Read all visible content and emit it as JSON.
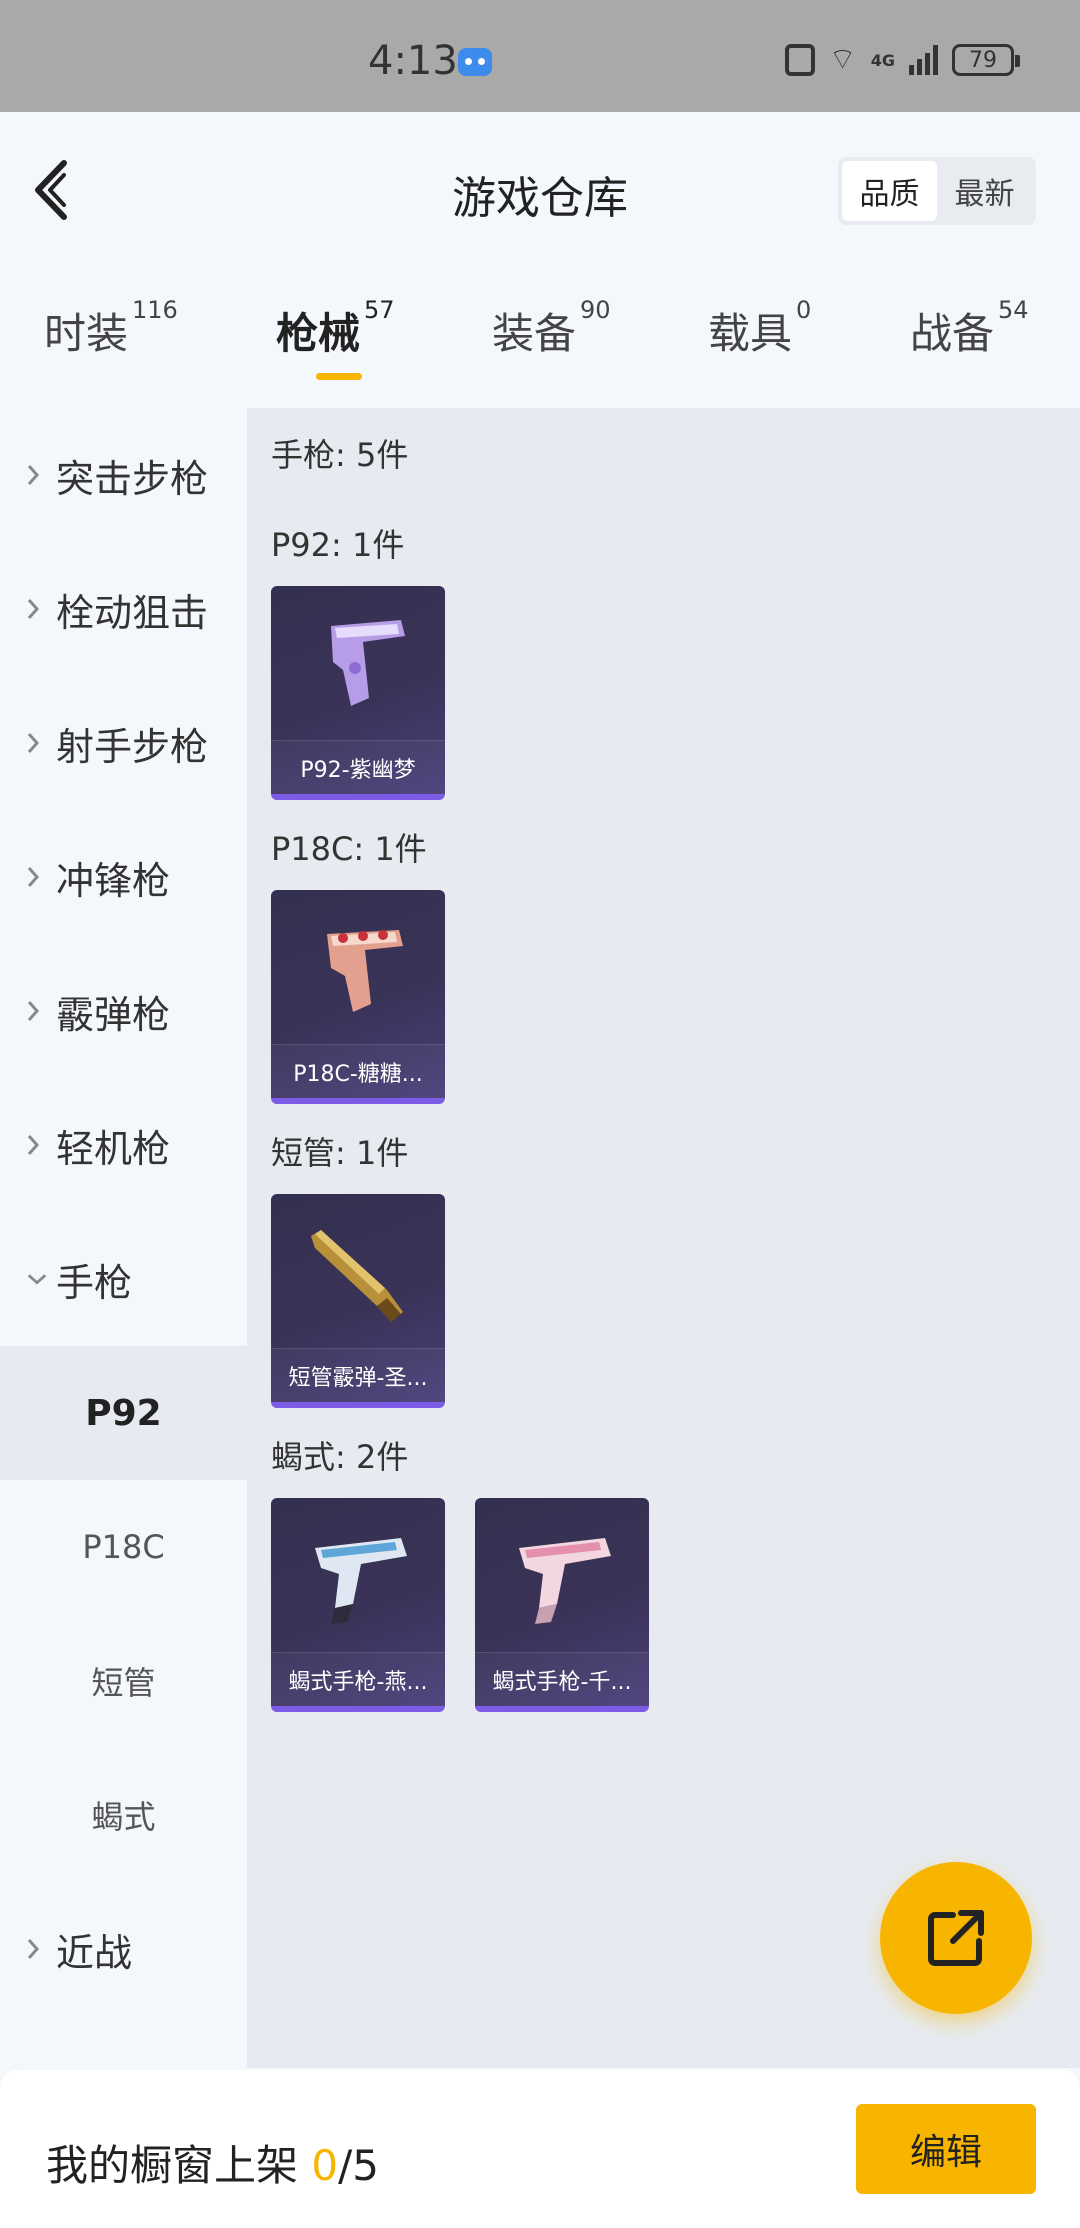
{
  "status_bar": {
    "time": "4:13",
    "signal_label": "4G",
    "battery": "79"
  },
  "header": {
    "title": "游戏仓库",
    "sort_options": [
      "品质",
      "最新"
    ],
    "active_sort": "品质"
  },
  "tabs": [
    {
      "label": "时装",
      "count": "116"
    },
    {
      "label": "枪械",
      "count": "57",
      "active": true
    },
    {
      "label": "装备",
      "count": "90"
    },
    {
      "label": "载具",
      "count": "0"
    },
    {
      "label": "战备",
      "count": "54"
    }
  ],
  "sidebar": {
    "categories": [
      "突击步枪",
      "栓动狙击",
      "射手步枪",
      "冲锋枪",
      "霰弹枪",
      "轻机枪",
      "手枪",
      "近战"
    ],
    "expanded": "手枪",
    "subitems": [
      "P92",
      "P18C",
      "短管",
      "蝎式"
    ],
    "active_subitem": "P92"
  },
  "content": {
    "summary": "手枪: 5件",
    "groups": [
      {
        "title": "P92: 1件",
        "items": [
          {
            "name": "P92-紫幽梦"
          }
        ]
      },
      {
        "title": "P18C: 1件",
        "items": [
          {
            "name": "P18C-糖糖..."
          }
        ]
      },
      {
        "title": "短管: 1件",
        "items": [
          {
            "name": "短管霰弹-圣..."
          }
        ]
      },
      {
        "title": "蝎式: 2件",
        "items": [
          {
            "name": "蝎式手枪-燕..."
          },
          {
            "name": "蝎式手枪-千..."
          }
        ]
      }
    ]
  },
  "bottom_bar": {
    "label": "我的橱窗上架",
    "current": "0",
    "total": "/5",
    "edit_label": "编辑"
  },
  "colors": {
    "accent": "#f7b500",
    "card_bg": "#3a3358",
    "card_border": "#7c5ce6",
    "status_bar": "#a9a9a9"
  }
}
